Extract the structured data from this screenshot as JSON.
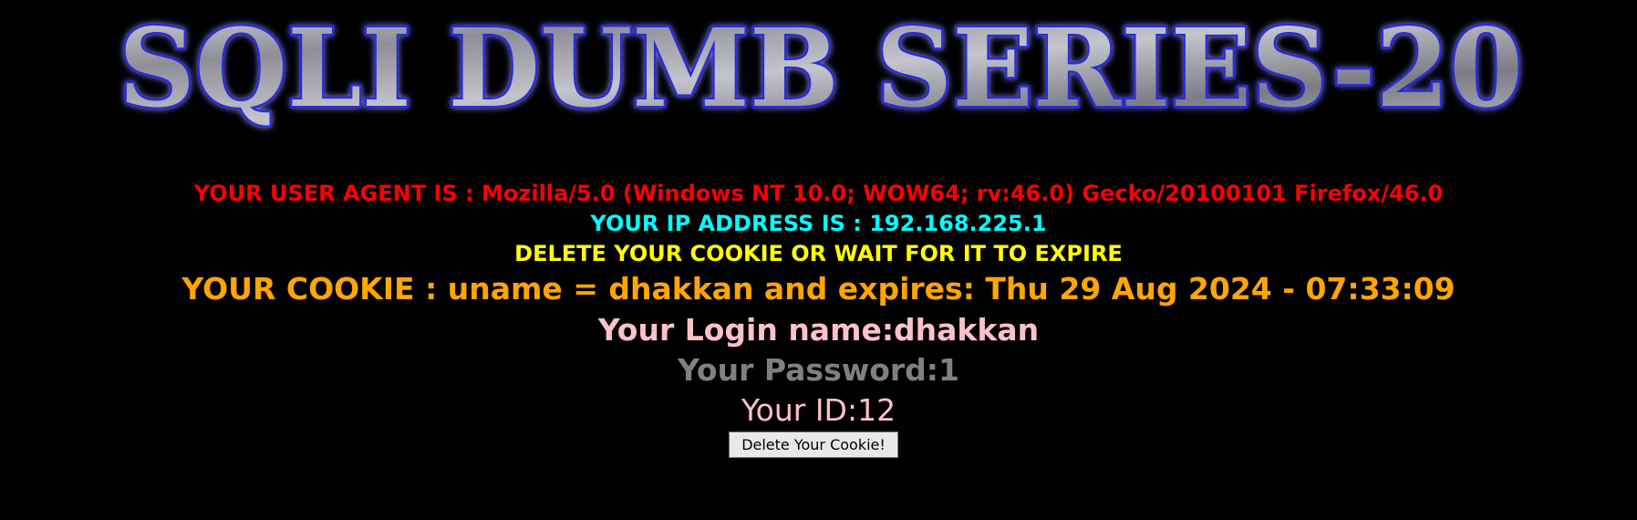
{
  "banner": {
    "title": "SQLI DUMB SERIES-20"
  },
  "info": {
    "user_agent": "YOUR USER AGENT IS : Mozilla/5.0 (Windows NT 10.0; WOW64; rv:46.0) Gecko/20100101 Firefox/46.0",
    "ip_address": "YOUR IP ADDRESS IS : 192.168.225.1",
    "delete_message": "DELETE YOUR COOKIE OR WAIT FOR IT TO EXPIRE",
    "cookie": "YOUR COOKIE : uname = dhakkan and expires: Thu 29 Aug 2024 - 07:33:09",
    "login_name": "Your Login name:dhakkan",
    "password": "Your Password:1",
    "id": "Your ID:12"
  },
  "button": {
    "delete_label": "Delete Your Cookie!"
  },
  "colors": {
    "background": "#000000",
    "user_agent": "#ff0000",
    "ip_address": "#00ffff",
    "delete_message": "#ffff00",
    "cookie": "#ffa500",
    "login_name": "#ffc0cb",
    "password": "#808080",
    "id": "#ffc0cb",
    "banner_fill": "#a9a9b4",
    "banner_outline": "#2a2adc"
  }
}
